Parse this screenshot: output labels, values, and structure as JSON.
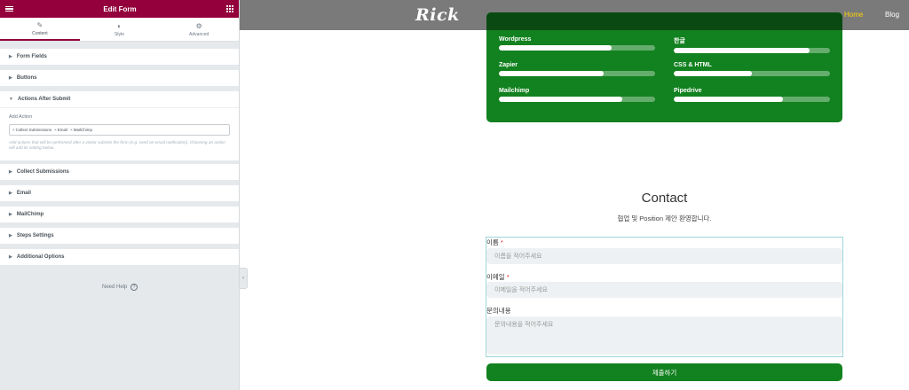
{
  "panel": {
    "title": "Edit Form",
    "tabs": [
      {
        "label": "Content",
        "icon": "pencil-icon"
      },
      {
        "label": "Style",
        "icon": "contrast-icon"
      },
      {
        "label": "Advanced",
        "icon": "gear-icon"
      }
    ],
    "sections": {
      "form_fields": "Form Fields",
      "buttons": "Buttons",
      "actions_after_submit": "Actions After Submit",
      "collect_submissions": "Collect Submissions",
      "email": "Email",
      "mailchimp": "MailChimp",
      "steps_settings": "Steps Settings",
      "additional_options": "Additional Options"
    },
    "add_action": {
      "label": "Add Action",
      "tags": [
        "Collect Submissions",
        "Email",
        "MailChimp"
      ],
      "help": "Add actions that will be performed after a visitor submits the form (e.g. send an email notification). Choosing an action will add its setting below."
    },
    "need_help": "Need Help"
  },
  "site": {
    "logo": "Rick",
    "nav": {
      "home": "Home",
      "blog": "Blog"
    },
    "accent_color": "#12811f"
  },
  "skills": [
    {
      "label": "Wordpress",
      "level": 0.72
    },
    {
      "label": "한글",
      "level": 0.87
    },
    {
      "label": "Zapier",
      "level": 0.67
    },
    {
      "label": "CSS & HTML",
      "level": 0.5
    },
    {
      "label": "Mailchimp",
      "level": 0.79
    },
    {
      "label": "Pipedrive",
      "level": 0.7
    }
  ],
  "contact": {
    "title": "Contact",
    "subtitle": "협업 및 Position 제안 환영합니다.",
    "name_label": "이름",
    "name_placeholder": "이름을 적어주세요",
    "email_label": "이메일",
    "email_placeholder": "이메일을 적어주세요",
    "message_label": "문의내용",
    "message_placeholder": "문의내용을 적어주세요",
    "required_mark": "*",
    "submit": "제출하기"
  }
}
